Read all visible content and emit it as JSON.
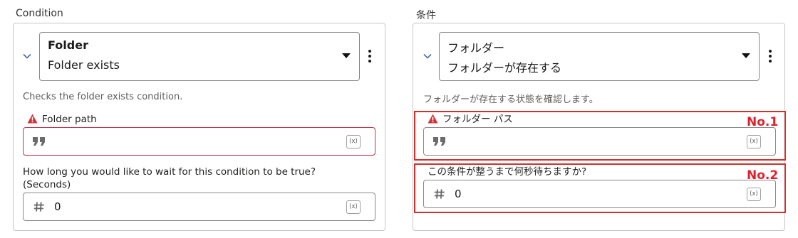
{
  "left_panel": {
    "title": "Condition",
    "dropdown": {
      "category": "Folder",
      "action": "Folder exists"
    },
    "description": "Checks the folder exists condition.",
    "folder_path": {
      "label": "Folder path",
      "value": "",
      "fx_label": "(x)"
    },
    "wait": {
      "label": "How long you would like to wait for this condition to be true? (Seconds)",
      "value": "0",
      "fx_label": "(x)"
    }
  },
  "right_panel": {
    "title": "条件",
    "dropdown": {
      "category": "フォルダー",
      "action": "フォルダーが存在する"
    },
    "description": "フォルダーが存在する状態を確認します。",
    "folder_path": {
      "label": "フォルダー パス",
      "value": "",
      "fx_label": "(x)"
    },
    "wait": {
      "label": "この条件が整うまで何秒待ちますか?",
      "value": "0",
      "fx_label": "(x)"
    }
  },
  "annotations": {
    "no1": "No.1",
    "no2": "No.2"
  },
  "icons": {
    "chevron": "chevron-down-icon",
    "kebab": "more-vertical-icon",
    "caret": "caret-down-icon",
    "warning": "warning-icon",
    "quote": "quote-icon",
    "hash": "hash-icon",
    "fx": "variable-icon"
  },
  "colors": {
    "error_border": "#c4314b",
    "warning_icon": "#d13438",
    "annotation_red": "#e0202c"
  }
}
